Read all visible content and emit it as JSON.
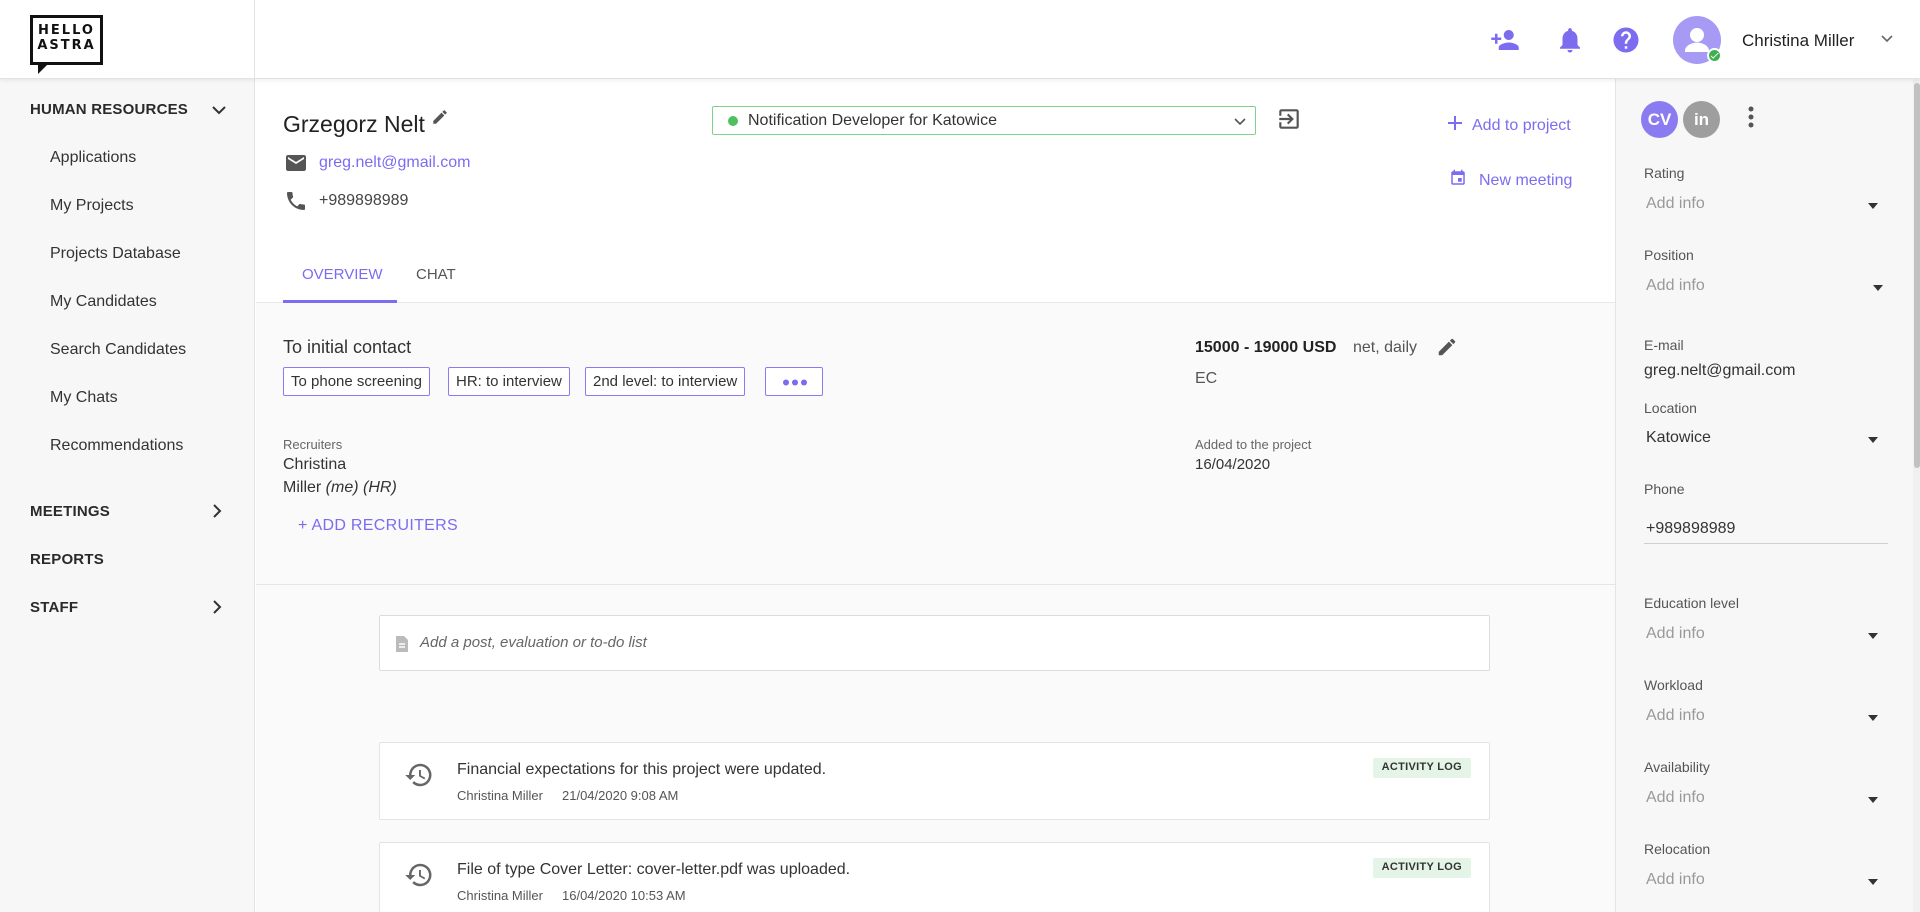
{
  "header": {
    "logo_text_line1": "HELLO",
    "logo_text_line2": "ASTRA",
    "user_name": "Christina Miller",
    "icons": [
      "add-person-icon",
      "bell-icon",
      "help-icon",
      "avatar-icon",
      "chevron-down-icon"
    ],
    "accent_color": "#7b6cf0"
  },
  "sidebar": {
    "sections": [
      {
        "label": "HUMAN RESOURCES",
        "expanded": true
      },
      {
        "label": "MEETINGS",
        "expanded": false
      },
      {
        "label": "REPORTS"
      },
      {
        "label": "STAFF",
        "expanded": false
      }
    ],
    "items": [
      "Applications",
      "My Projects",
      "Projects Database",
      "My Candidates",
      "Search Candidates",
      "My Chats",
      "Recommendations"
    ]
  },
  "candidate": {
    "name": "Grzegorz Nelt",
    "email": "greg.nelt@gmail.com",
    "phone": "+989898989",
    "project": "Notification Developer for Katowice",
    "project_status_color": "#4ec060",
    "add_to_project": "Add to project",
    "new_meeting": "New meeting"
  },
  "tabs": {
    "overview": "OVERVIEW",
    "chat": "CHAT",
    "active": "OVERVIEW"
  },
  "stage": {
    "title": "To initial contact",
    "buttons": [
      "To phone screening",
      "HR: to interview",
      "2nd level: to interview"
    ],
    "more": "•••",
    "salary": "15000 - 19000 USD",
    "salary_note": "net, daily",
    "currency_note": "EC",
    "recruiters_label": "Recruiters",
    "recruiter_first": "Christina",
    "recruiter_last": "Miller",
    "recruiter_suffix": "(me) (HR)",
    "added_label": "Added to the project",
    "added_date": "16/04/2020",
    "add_recruiters": "+ ADD RECRUITERS"
  },
  "feed": {
    "post_placeholder": "Add a post, evaluation or to-do list",
    "entries": [
      {
        "title": "Financial expectations for this project were updated.",
        "author": "Christina Miller",
        "time": "21/04/2020 9:08 AM",
        "badge": "ACTIVITY LOG"
      },
      {
        "title": "File of type Cover Letter: cover-letter.pdf was uploaded.",
        "author": "Christina Miller",
        "time": "16/04/2020 10:53 AM",
        "badge": "ACTIVITY LOG"
      }
    ]
  },
  "right_panel": {
    "cv_badge": "CV",
    "in_badge": "in",
    "placeholder": "Add info",
    "rating_label": "Rating",
    "position_label": "Position",
    "email_label": "E-mail",
    "email_value": "greg.nelt@gmail.com",
    "location_label": "Location",
    "location_value": "Katowice",
    "phone_label": "Phone",
    "phone_value": "+989898989",
    "education_label": "Education level",
    "workload_label": "Workload",
    "availability_label": "Availability",
    "relocation_label": "Relocation"
  }
}
